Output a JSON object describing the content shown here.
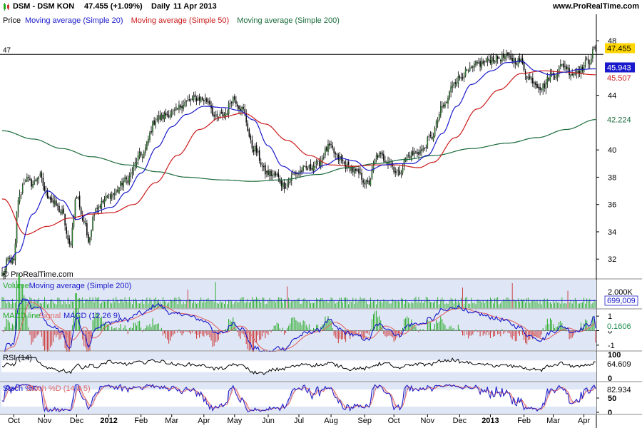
{
  "header": {
    "symbol": "DSM - DSM KON",
    "last": "47.455 (+1.09%)",
    "period": "Daily",
    "date": "11 Apr 2013",
    "site": "www.ProRealTime.com"
  },
  "watermark": "© ProRealTime.com",
  "colors": {
    "sma20": "#1a1acc",
    "sma50": "#cc1a1a",
    "sma200": "#1a6b3a",
    "pane_bg": "#ffffff",
    "ind_bg": "#dfe6f5",
    "vol_bar": "#22aa22",
    "vol_ma": "#1a1acc",
    "macd_line": "#1a1acc",
    "signal_line": "#e06a6a",
    "hist_pos": "#22aa22",
    "hist_neg": "#cc3333",
    "rsi_line": "#000000",
    "stoch_k": "#1a1acc",
    "stoch_d": "#e06a6a",
    "last_box": "#ffd700",
    "sma20_box": "#1a1acc",
    "sma50_box": "#cc1a1a",
    "sma200_box": "#1a6b3a"
  },
  "chart_data": [
    {
      "type": "candlestick",
      "pane": "price",
      "legend": [
        {
          "label": "Price",
          "color": "#000000"
        },
        {
          "label": "Moving average (Simple 20)",
          "color": "#1a1acc"
        },
        {
          "label": "Moving average (Simple 50)",
          "color": "#cc1a1a"
        },
        {
          "label": "Moving average (Simple 200)",
          "color": "#1a6b3a"
        }
      ],
      "ylim": [
        30.6,
        49.0
      ],
      "y_ticks": [
        "48",
        "44",
        "40",
        "38",
        "36",
        "34",
        "32"
      ],
      "y_tick_values": [
        48,
        44,
        40,
        38,
        36,
        34,
        32
      ],
      "horizontal_line": {
        "value": 47,
        "label": "47"
      },
      "value_labels": [
        {
          "text": "47.455",
          "value": 47.455,
          "style": "last"
        },
        {
          "text": "45.943",
          "value": 45.943,
          "style": "sma20"
        },
        {
          "text": "45.507",
          "value": 45.507,
          "style": "sma50"
        },
        {
          "text": "42.224",
          "value": 42.224,
          "style": "sma200"
        }
      ],
      "close_anchors": [
        [
          "2011-09-22",
          30.9
        ],
        [
          "2011-09-27",
          32.0
        ],
        [
          "2011-10-01",
          31.8
        ],
        [
          "2011-10-06",
          36.4
        ],
        [
          "2011-10-13",
          37.9
        ],
        [
          "2011-10-20",
          37.5
        ],
        [
          "2011-10-26",
          38.1
        ],
        [
          "2011-11-03",
          36.7
        ],
        [
          "2011-11-10",
          36.0
        ],
        [
          "2011-11-17",
          35.4
        ],
        [
          "2011-11-24",
          33.0
        ],
        [
          "2011-12-01",
          36.6
        ],
        [
          "2011-12-08",
          34.7
        ],
        [
          "2011-12-13",
          33.5
        ],
        [
          "2011-12-20",
          35.8
        ],
        [
          "2012-01-04",
          36.7
        ],
        [
          "2012-01-18",
          37.8
        ],
        [
          "2012-02-01",
          39.6
        ],
        [
          "2012-02-16",
          42.3
        ],
        [
          "2012-03-01",
          42.7
        ],
        [
          "2012-03-15",
          43.5
        ],
        [
          "2012-03-26",
          43.8
        ],
        [
          "2012-04-05",
          43.6
        ],
        [
          "2012-04-12",
          42.3
        ],
        [
          "2012-04-20",
          42.6
        ],
        [
          "2012-04-30",
          43.8
        ],
        [
          "2012-05-08",
          43.0
        ],
        [
          "2012-05-18",
          40.1
        ],
        [
          "2012-05-31",
          38.3
        ],
        [
          "2012-06-08",
          38.1
        ],
        [
          "2012-06-18",
          37.4
        ],
        [
          "2012-06-28",
          38.3
        ],
        [
          "2012-07-09",
          38.6
        ],
        [
          "2012-07-18",
          38.9
        ],
        [
          "2012-07-31",
          40.2
        ],
        [
          "2012-08-08",
          39.4
        ],
        [
          "2012-08-16",
          38.8
        ],
        [
          "2012-08-27",
          38.3
        ],
        [
          "2012-09-05",
          37.5
        ],
        [
          "2012-09-14",
          39.6
        ],
        [
          "2012-09-24",
          39.3
        ],
        [
          "2012-10-04",
          38.3
        ],
        [
          "2012-10-15",
          39.6
        ],
        [
          "2012-10-26",
          39.9
        ],
        [
          "2012-11-05",
          40.9
        ],
        [
          "2012-11-16",
          43.2
        ],
        [
          "2012-11-28",
          45.1
        ],
        [
          "2012-12-10",
          45.7
        ],
        [
          "2012-12-20",
          46.3
        ],
        [
          "2013-01-04",
          46.7
        ],
        [
          "2013-01-15",
          46.8
        ],
        [
          "2013-01-29",
          46.5
        ],
        [
          "2013-02-07",
          45.2
        ],
        [
          "2013-02-19",
          44.6
        ],
        [
          "2013-02-28",
          45.5
        ],
        [
          "2013-03-12",
          46.2
        ],
        [
          "2013-03-20",
          45.6
        ],
        [
          "2013-03-27",
          45.9
        ],
        [
          "2013-04-04",
          46.5
        ],
        [
          "2013-04-11",
          47.455
        ]
      ],
      "sma20_anchors": [
        [
          "2011-09-22",
          31.4
        ],
        [
          "2011-10-06",
          32.5
        ],
        [
          "2011-10-20",
          35.3
        ],
        [
          "2011-11-03",
          37.0
        ],
        [
          "2011-11-17",
          36.3
        ],
        [
          "2011-12-01",
          34.9
        ],
        [
          "2011-12-15",
          35.4
        ],
        [
          "2012-01-04",
          35.8
        ],
        [
          "2012-01-18",
          36.9
        ],
        [
          "2012-02-01",
          38.3
        ],
        [
          "2012-02-16",
          40.2
        ],
        [
          "2012-03-01",
          41.7
        ],
        [
          "2012-03-15",
          42.6
        ],
        [
          "2012-04-02",
          43.2
        ],
        [
          "2012-04-20",
          43.1
        ],
        [
          "2012-05-04",
          42.9
        ],
        [
          "2012-05-18",
          42.2
        ],
        [
          "2012-06-01",
          40.3
        ],
        [
          "2012-06-15",
          38.8
        ],
        [
          "2012-06-28",
          38.3
        ],
        [
          "2012-07-12",
          38.3
        ],
        [
          "2012-07-26",
          38.9
        ],
        [
          "2012-08-09",
          39.4
        ],
        [
          "2012-08-23",
          39.2
        ],
        [
          "2012-09-06",
          38.5
        ],
        [
          "2012-09-20",
          38.9
        ],
        [
          "2012-10-04",
          39.0
        ],
        [
          "2012-10-18",
          39.0
        ],
        [
          "2012-11-01",
          39.6
        ],
        [
          "2012-11-15",
          41.2
        ],
        [
          "2012-11-29",
          43.2
        ],
        [
          "2012-12-13",
          44.8
        ],
        [
          "2013-01-02",
          45.8
        ],
        [
          "2013-01-16",
          46.4
        ],
        [
          "2013-01-30",
          46.5
        ],
        [
          "2013-02-13",
          45.8
        ],
        [
          "2013-02-27",
          45.5
        ],
        [
          "2013-03-13",
          45.7
        ],
        [
          "2013-03-27",
          45.9
        ],
        [
          "2013-04-11",
          45.943
        ]
      ],
      "sma50_anchors": [
        [
          "2011-09-22",
          36.4
        ],
        [
          "2011-10-13",
          33.8
        ],
        [
          "2011-11-03",
          34.4
        ],
        [
          "2011-11-24",
          35.0
        ],
        [
          "2011-12-15",
          35.3
        ],
        [
          "2012-01-04",
          35.4
        ],
        [
          "2012-01-25",
          36.0
        ],
        [
          "2012-02-15",
          37.6
        ],
        [
          "2012-03-07",
          39.6
        ],
        [
          "2012-03-28",
          41.5
        ],
        [
          "2012-04-18",
          42.4
        ],
        [
          "2012-05-09",
          42.7
        ],
        [
          "2012-05-30",
          41.9
        ],
        [
          "2012-06-20",
          40.7
        ],
        [
          "2012-07-11",
          39.6
        ],
        [
          "2012-08-01",
          38.9
        ],
        [
          "2012-08-22",
          38.8
        ],
        [
          "2012-09-12",
          38.9
        ],
        [
          "2012-10-03",
          38.9
        ],
        [
          "2012-10-24",
          38.7
        ],
        [
          "2012-11-07",
          39.1
        ],
        [
          "2012-11-28",
          40.9
        ],
        [
          "2012-12-19",
          43.0
        ],
        [
          "2013-01-09",
          44.4
        ],
        [
          "2013-01-30",
          45.6
        ],
        [
          "2013-02-20",
          45.8
        ],
        [
          "2013-03-13",
          45.7
        ],
        [
          "2013-04-11",
          45.507
        ]
      ],
      "sma200_anchors": [
        [
          "2011-09-22",
          41.4
        ],
        [
          "2011-10-20",
          40.8
        ],
        [
          "2011-11-17",
          40.1
        ],
        [
          "2011-12-15",
          39.5
        ],
        [
          "2012-01-19",
          38.9
        ],
        [
          "2012-02-16",
          38.4
        ],
        [
          "2012-03-15",
          38.0
        ],
        [
          "2012-04-19",
          37.8
        ],
        [
          "2012-05-17",
          37.7
        ],
        [
          "2012-06-14",
          37.8
        ],
        [
          "2012-07-19",
          38.2
        ],
        [
          "2012-08-16",
          38.7
        ],
        [
          "2012-09-13",
          39.0
        ],
        [
          "2012-10-11",
          39.3
        ],
        [
          "2012-11-08",
          39.6
        ],
        [
          "2012-12-13",
          40.1
        ],
        [
          "2013-01-17",
          40.5
        ],
        [
          "2013-02-14",
          40.9
        ],
        [
          "2013-03-14",
          41.5
        ],
        [
          "2013-04-11",
          42.224
        ]
      ]
    },
    {
      "type": "bar",
      "pane": "volume",
      "legend": [
        {
          "label": "Volume",
          "color": "#22aa22"
        },
        {
          "label": "Moving average (Simple 200)",
          "color": "#1a1acc"
        }
      ],
      "y_ticks": [
        "2.000K"
      ],
      "ylim": [
        0,
        2500
      ],
      "value_labels": [
        {
          "text": "699,009",
          "value": 699,
          "style": "vol"
        }
      ],
      "ma_level": 700,
      "spikes": [
        [
          "2012-04-12",
          2400
        ],
        [
          "2012-06-20",
          2000
        ],
        [
          "2013-01-22",
          2300
        ],
        [
          "2012-12-05",
          1900
        ],
        [
          "2012-03-16",
          1700
        ],
        [
          "2013-03-15",
          1600
        ]
      ]
    },
    {
      "type": "line",
      "pane": "macd",
      "legend": [
        {
          "label": "MACD line",
          "color": "#22aa22"
        },
        {
          "label": "Signal",
          "color": "#e06a6a"
        },
        {
          "label": "MACD (12 26 9)",
          "color": "#1a1acc"
        }
      ],
      "ylim": [
        -1.35,
        1.45
      ],
      "y_ticks": [
        "1",
        "0",
        "-1"
      ],
      "y_tick_values": [
        1,
        0,
        -1
      ],
      "value_labels": [
        {
          "text": "0.1606",
          "value": 0.1606,
          "style": "macd"
        }
      ]
    },
    {
      "type": "line",
      "pane": "rsi",
      "legend": [
        {
          "label": "RSI (14)",
          "color": "#000000"
        }
      ],
      "ylim": [
        0,
        100
      ],
      "y_ticks": [
        "100",
        "0"
      ],
      "y_tick_values": [
        100,
        0
      ],
      "value_labels": [
        {
          "text": "64.609",
          "value": 64.609,
          "style": "rsi"
        }
      ]
    },
    {
      "type": "line",
      "pane": "stoch",
      "legend": [
        {
          "label": "Stoch %K",
          "color": "#1a1acc"
        },
        {
          "label": "Stoch %D (14 3 5)",
          "color": "#e06a6a"
        }
      ],
      "ylim": [
        -5,
        105
      ],
      "y_ticks": [
        "50",
        "0"
      ],
      "y_tick_values": [
        50,
        0
      ],
      "value_labels": [
        {
          "text": "82.934",
          "value": 82.934,
          "style": "stoch"
        }
      ]
    }
  ],
  "x_axis": {
    "ticks": [
      {
        "label": "Oct",
        "date": "2011-10-01"
      },
      {
        "label": "Nov",
        "date": "2011-11-01"
      },
      {
        "label": "Dec",
        "date": "2011-12-01"
      },
      {
        "label": "2012",
        "date": "2012-01-01",
        "bold": true
      },
      {
        "label": "Feb",
        "date": "2012-02-01"
      },
      {
        "label": "Mar",
        "date": "2012-03-01"
      },
      {
        "label": "Apr",
        "date": "2012-04-01"
      },
      {
        "label": "May",
        "date": "2012-05-01"
      },
      {
        "label": "Jun",
        "date": "2012-06-01"
      },
      {
        "label": "Jul",
        "date": "2012-07-01"
      },
      {
        "label": "Aug",
        "date": "2012-08-01"
      },
      {
        "label": "Sep",
        "date": "2012-09-01"
      },
      {
        "label": "Oct",
        "date": "2012-10-01"
      },
      {
        "label": "Nov",
        "date": "2012-11-01"
      },
      {
        "label": "Dec",
        "date": "2012-12-01"
      },
      {
        "label": "2013",
        "date": "2013-01-01",
        "bold": true
      },
      {
        "label": "Feb",
        "date": "2013-02-01"
      },
      {
        "label": "Mar",
        "date": "2013-03-01"
      },
      {
        "label": "Apr",
        "date": "2013-04-01"
      }
    ],
    "range": [
      "2011-09-21",
      "2013-04-11"
    ]
  }
}
